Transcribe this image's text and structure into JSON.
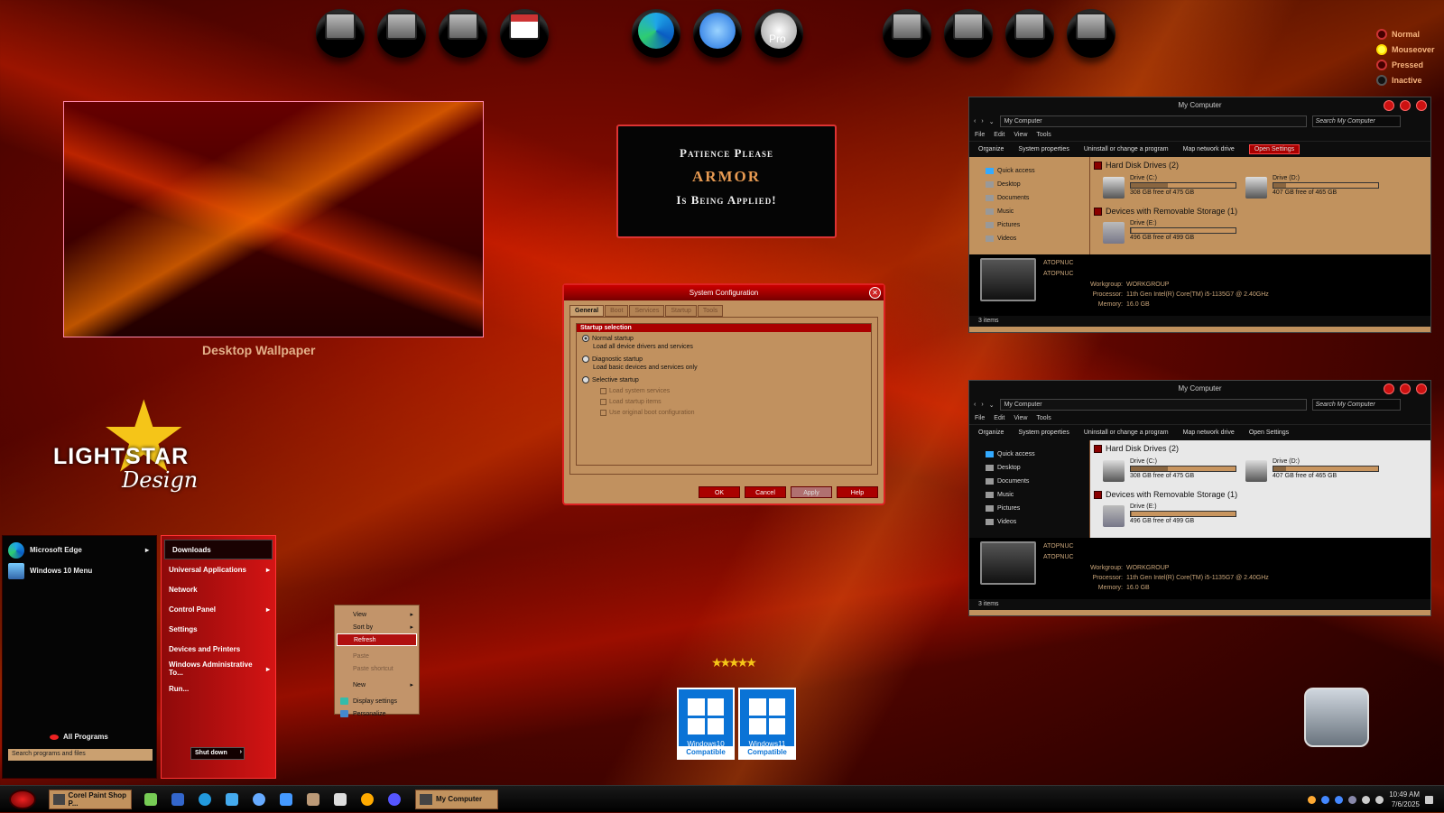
{
  "legend": {
    "items": [
      "Normal",
      "Mouseover",
      "Pressed",
      "Inactive"
    ]
  },
  "wallpaper": {
    "label": "Desktop Wallpaper"
  },
  "patience": {
    "line1": "Patience Please",
    "line2": "ARMOR",
    "line3": "Is Being Applied!"
  },
  "logo": {
    "line1": "LIGHTSTAR",
    "line2": "Design"
  },
  "start": {
    "left_items": [
      {
        "label": "Microsoft Edge",
        "icon": "edge-icon"
      },
      {
        "label": "Windows 10 Menu",
        "icon": "windows-menu-icon"
      }
    ],
    "right_items": [
      "Downloads",
      "Universal Applications",
      "Network",
      "Control Panel",
      "Settings",
      "Devices and Printers",
      "Windows Administrative To...",
      "Run..."
    ],
    "all_programs": "All Programs",
    "search_placeholder": "Search programs and files",
    "shutdown": "Shut down"
  },
  "context": {
    "items": [
      "View",
      "Sort by",
      "Refresh",
      "Paste",
      "Paste shortcut",
      "New",
      "Display settings",
      "Personalize"
    ]
  },
  "sysconfig": {
    "title": "System Configuration",
    "tabs": [
      "General",
      "Boot",
      "Services",
      "Startup",
      "Tools"
    ],
    "group": "Startup selection",
    "options": [
      {
        "label": "Normal startup",
        "desc": "Load all device drivers and services"
      },
      {
        "label": "Diagnostic startup",
        "desc": "Load basic devices and services only"
      },
      {
        "label": "Selective startup",
        "desc": ""
      }
    ],
    "checks": [
      "Load system services",
      "Load startup items",
      "Use original boot configuration"
    ],
    "buttons": [
      "OK",
      "Cancel",
      "Apply",
      "Help"
    ]
  },
  "explorer": {
    "title": "My Computer",
    "address": "My Computer",
    "search": "Search My Computer",
    "menu": [
      "File",
      "Edit",
      "View",
      "Tools"
    ],
    "commands": [
      "Organize",
      "System properties",
      "Uninstall or change a program",
      "Map network drive",
      "Open Settings"
    ],
    "nav": [
      "Quick access",
      "Desktop",
      "Documents",
      "Music",
      "Pictures",
      "Videos"
    ],
    "hdd_section": "Hard Disk Drives (2)",
    "removable_section": "Devices with Removable Storage (1)",
    "drives": [
      {
        "name": "Drive (C:)",
        "free": "308 GB free of 475 GB",
        "used_fraction": 0.35
      },
      {
        "name": "Drive (D:)",
        "free": "407 GB free of 465 GB",
        "used_fraction": 0.12
      },
      {
        "name": "Drive (E:)",
        "free": "496 GB free of 499 GB",
        "used_fraction": 0.01
      }
    ],
    "computer_name": "ATOPNUC",
    "computer_name2": "ATOPNUC",
    "workgroup_label": "Workgroup:",
    "workgroup": "WORKGROUP",
    "processor_label": "Processor:",
    "processor": "11th Gen Intel(R) Core(TM) i5-1135G7 @ 2.40GHz",
    "memory_label": "Memory:",
    "memory": "16.0 GB",
    "status": "3 items"
  },
  "badges": [
    {
      "line1": "Windows10",
      "line2": "Compatible"
    },
    {
      "line1": "Windows11",
      "line2": "Compatible"
    }
  ],
  "taskbar": {
    "task1": "Corel Paint Shop P...",
    "task2": "My Computer",
    "time": "10:49 AM",
    "date": "7/6/2025"
  }
}
